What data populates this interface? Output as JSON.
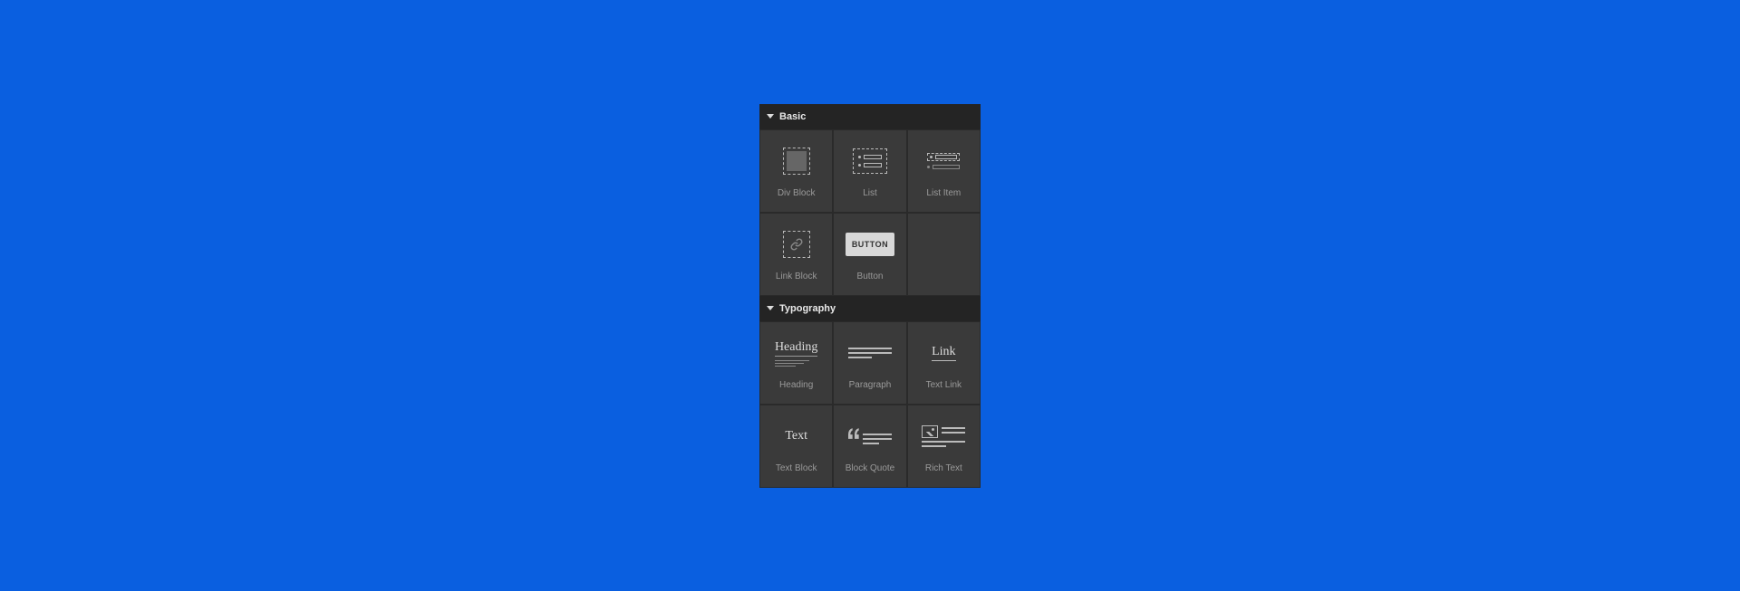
{
  "sections": {
    "basic": {
      "title": "Basic",
      "items": {
        "div_block": {
          "label": "Div Block"
        },
        "list": {
          "label": "List"
        },
        "list_item": {
          "label": "List Item"
        },
        "link_block": {
          "label": "Link Block"
        },
        "button": {
          "label": "Button",
          "icon_text": "BUTTON"
        }
      }
    },
    "typography": {
      "title": "Typography",
      "items": {
        "heading": {
          "label": "Heading",
          "icon_text": "Heading"
        },
        "paragraph": {
          "label": "Paragraph"
        },
        "text_link": {
          "label": "Text Link",
          "icon_text": "Link"
        },
        "text_block": {
          "label": "Text Block",
          "icon_text": "Text"
        },
        "block_quote": {
          "label": "Block Quote"
        },
        "rich_text": {
          "label": "Rich Text"
        }
      }
    }
  }
}
